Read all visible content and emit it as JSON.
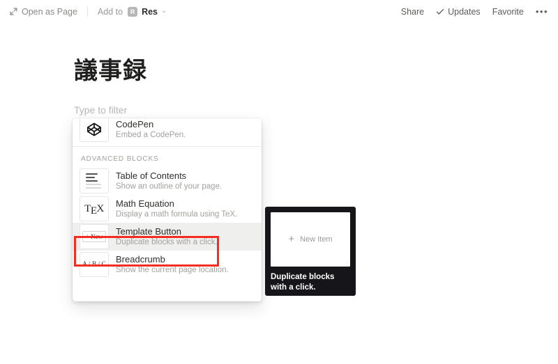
{
  "topbar": {
    "open_as_page": "Open as Page",
    "open_as_page_icon": "expand-arrow-icon",
    "add_to_label": "Add to",
    "add_to_badge": "R",
    "add_to_value": "Res",
    "add_to_chevron": "⌄",
    "share": "Share",
    "updates": "Updates",
    "updates_icon": "check-icon",
    "favorite": "Favorite",
    "more": "•••"
  },
  "page": {
    "title": "議事録",
    "filter_placeholder": "Type to filter"
  },
  "menu": {
    "section_label": "ADVANCED BLOCKS",
    "items": [
      {
        "title": "CodePen",
        "desc": "Embed a CodePen.",
        "icon": "codepen-icon",
        "hovered": false
      },
      {
        "title": "Table of Contents",
        "desc": "Show an outline of your page.",
        "icon": "table-of-contents-icon",
        "hovered": false
      },
      {
        "title": "Math Equation",
        "desc": "Display a math formula using TeX.",
        "icon": "tex-icon",
        "icon_text": "TEX",
        "hovered": false
      },
      {
        "title": "Template Button",
        "desc": "Duplicate blocks with a click.",
        "icon": "new-button-icon",
        "icon_text": "+ New",
        "hovered": true
      },
      {
        "title": "Breadcrumb",
        "desc": "Show the current page location.",
        "icon": "breadcrumb-icon",
        "icon_text": "A / B / C",
        "hovered": false
      }
    ]
  },
  "preview": {
    "card_label": "New Item",
    "card_plus": "+",
    "caption": "Duplicate blocks with a click."
  },
  "highlight": {
    "color": "#f72c20",
    "target": "Template Button"
  }
}
